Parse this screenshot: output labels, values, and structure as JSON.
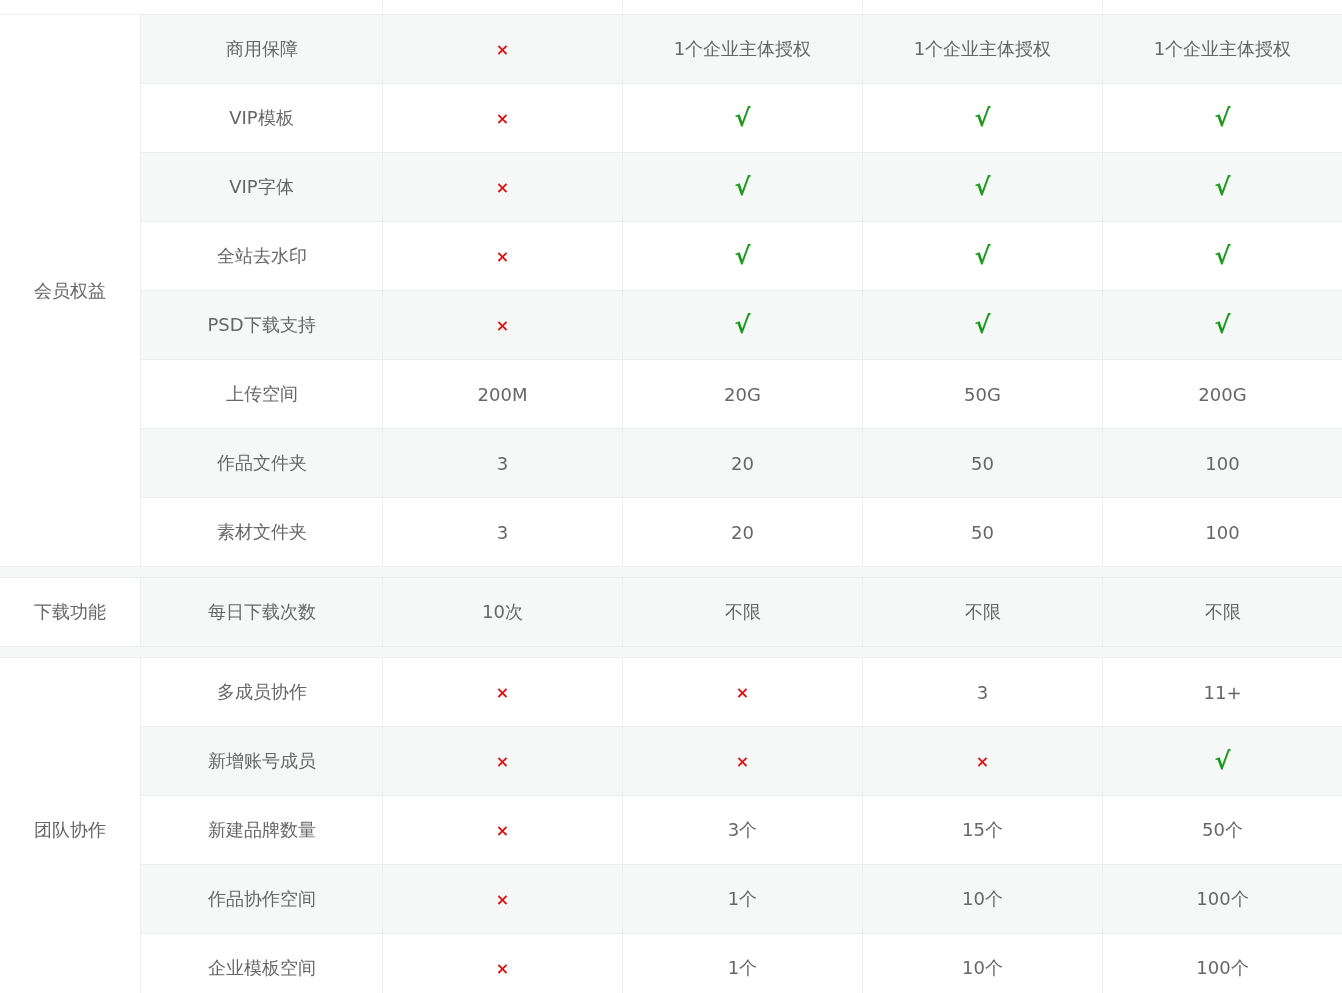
{
  "groups": [
    {
      "name": "会员权益",
      "rows": [
        {
          "feature": "商用保障",
          "cells": [
            {
              "kind": "no",
              "text": "×"
            },
            {
              "kind": "text",
              "text": "1个企业主体授权"
            },
            {
              "kind": "text",
              "text": "1个企业主体授权"
            },
            {
              "kind": "text",
              "text": "1个企业主体授权"
            }
          ]
        },
        {
          "feature": "VIP模板",
          "cells": [
            {
              "kind": "no",
              "text": "×"
            },
            {
              "kind": "yes",
              "text": "√"
            },
            {
              "kind": "yes",
              "text": "√"
            },
            {
              "kind": "yes",
              "text": "√"
            }
          ]
        },
        {
          "feature": "VIP字体",
          "cells": [
            {
              "kind": "no",
              "text": "×"
            },
            {
              "kind": "yes",
              "text": "√"
            },
            {
              "kind": "yes",
              "text": "√"
            },
            {
              "kind": "yes",
              "text": "√"
            }
          ]
        },
        {
          "feature": "全站去水印",
          "cells": [
            {
              "kind": "no",
              "text": "×"
            },
            {
              "kind": "yes",
              "text": "√"
            },
            {
              "kind": "yes",
              "text": "√"
            },
            {
              "kind": "yes",
              "text": "√"
            }
          ]
        },
        {
          "feature": "PSD下载支持",
          "cells": [
            {
              "kind": "no",
              "text": "×"
            },
            {
              "kind": "yes",
              "text": "√"
            },
            {
              "kind": "yes",
              "text": "√"
            },
            {
              "kind": "yes",
              "text": "√"
            }
          ]
        },
        {
          "feature": "上传空间",
          "cells": [
            {
              "kind": "text",
              "text": "200M"
            },
            {
              "kind": "text",
              "text": "20G"
            },
            {
              "kind": "text",
              "text": "50G"
            },
            {
              "kind": "text",
              "text": "200G"
            }
          ]
        },
        {
          "feature": "作品文件夹",
          "cells": [
            {
              "kind": "text",
              "text": "3"
            },
            {
              "kind": "text",
              "text": "20"
            },
            {
              "kind": "text",
              "text": "50"
            },
            {
              "kind": "text",
              "text": "100"
            }
          ]
        },
        {
          "feature": "素材文件夹",
          "cells": [
            {
              "kind": "text",
              "text": "3"
            },
            {
              "kind": "text",
              "text": "20"
            },
            {
              "kind": "text",
              "text": "50"
            },
            {
              "kind": "text",
              "text": "100"
            }
          ]
        }
      ]
    },
    {
      "name": "下载功能",
      "rows": [
        {
          "feature": "每日下载次数",
          "cells": [
            {
              "kind": "text",
              "text": "10次"
            },
            {
              "kind": "text",
              "text": "不限"
            },
            {
              "kind": "text",
              "text": "不限"
            },
            {
              "kind": "text",
              "text": "不限"
            }
          ]
        }
      ]
    },
    {
      "name": "团队协作",
      "rows": [
        {
          "feature": "多成员协作",
          "cells": [
            {
              "kind": "no",
              "text": "×"
            },
            {
              "kind": "no",
              "text": "×"
            },
            {
              "kind": "text",
              "text": "3"
            },
            {
              "kind": "text",
              "text": "11+"
            }
          ]
        },
        {
          "feature": "新增账号成员",
          "cells": [
            {
              "kind": "no",
              "text": "×"
            },
            {
              "kind": "no",
              "text": "×"
            },
            {
              "kind": "no",
              "text": "×"
            },
            {
              "kind": "yes",
              "text": "√"
            }
          ]
        },
        {
          "feature": "新建品牌数量",
          "cells": [
            {
              "kind": "no",
              "text": "×"
            },
            {
              "kind": "text",
              "text": "3个"
            },
            {
              "kind": "text",
              "text": "15个"
            },
            {
              "kind": "text",
              "text": "50个"
            }
          ]
        },
        {
          "feature": "作品协作空间",
          "cells": [
            {
              "kind": "no",
              "text": "×"
            },
            {
              "kind": "text",
              "text": "1个"
            },
            {
              "kind": "text",
              "text": "10个"
            },
            {
              "kind": "text",
              "text": "100个"
            }
          ]
        },
        {
          "feature": "企业模板空间",
          "cells": [
            {
              "kind": "no",
              "text": "×"
            },
            {
              "kind": "text",
              "text": "1个"
            },
            {
              "kind": "text",
              "text": "10个"
            },
            {
              "kind": "text",
              "text": "100个"
            }
          ]
        }
      ]
    }
  ]
}
